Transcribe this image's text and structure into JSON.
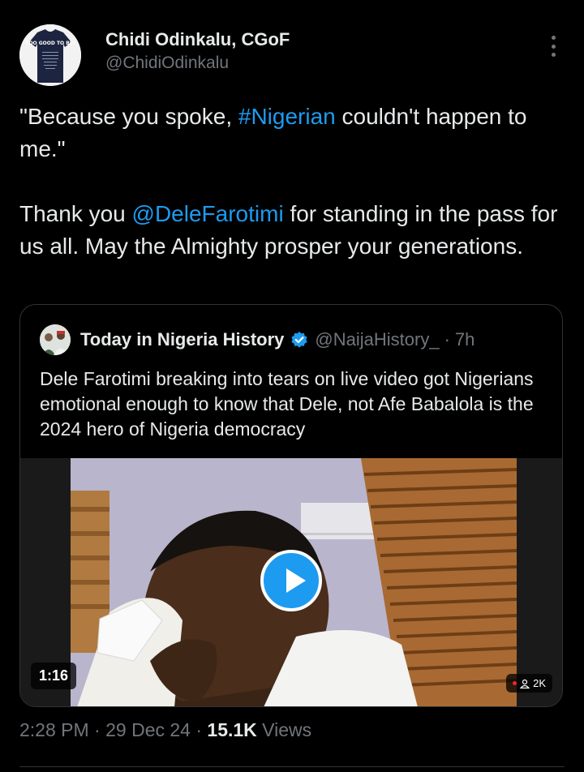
{
  "author": {
    "name": "Chidi Odinkalu, CGoF",
    "handle": "@ChidiOdinkalu",
    "avatar_shirt_text": "TOO GOOD TO BE!"
  },
  "tweet": {
    "part1": "\"Because you spoke, ",
    "hashtag": "#Nigerian",
    "part2": " couldn't happen to me.\"\n\nThank you ",
    "mention": "@DeleFarotimi",
    "part3": " for standing in the pass for us all. May the Almighty prosper your generations."
  },
  "quote": {
    "name": "Today in Nigeria History",
    "handle": "@NaijaHistory_",
    "dot": "·",
    "time": "7h",
    "text": "Dele Farotimi breaking into tears on live video got Nigerians emotional enough to know that Dele, not Afe Babalola is the 2024 hero of Nigeria democracy",
    "video": {
      "duration": "1:16",
      "views": "2K"
    }
  },
  "meta": {
    "time": "2:28 PM",
    "sep1": " · ",
    "date": "29 Dec 24",
    "sep2": " · ",
    "views_count": "15.1K",
    "views_label": " Views"
  },
  "colors": {
    "background": "#000000",
    "text": "#e7e9ea",
    "secondary": "#71767b",
    "link": "#1d9bf0",
    "border": "#2f3336"
  }
}
